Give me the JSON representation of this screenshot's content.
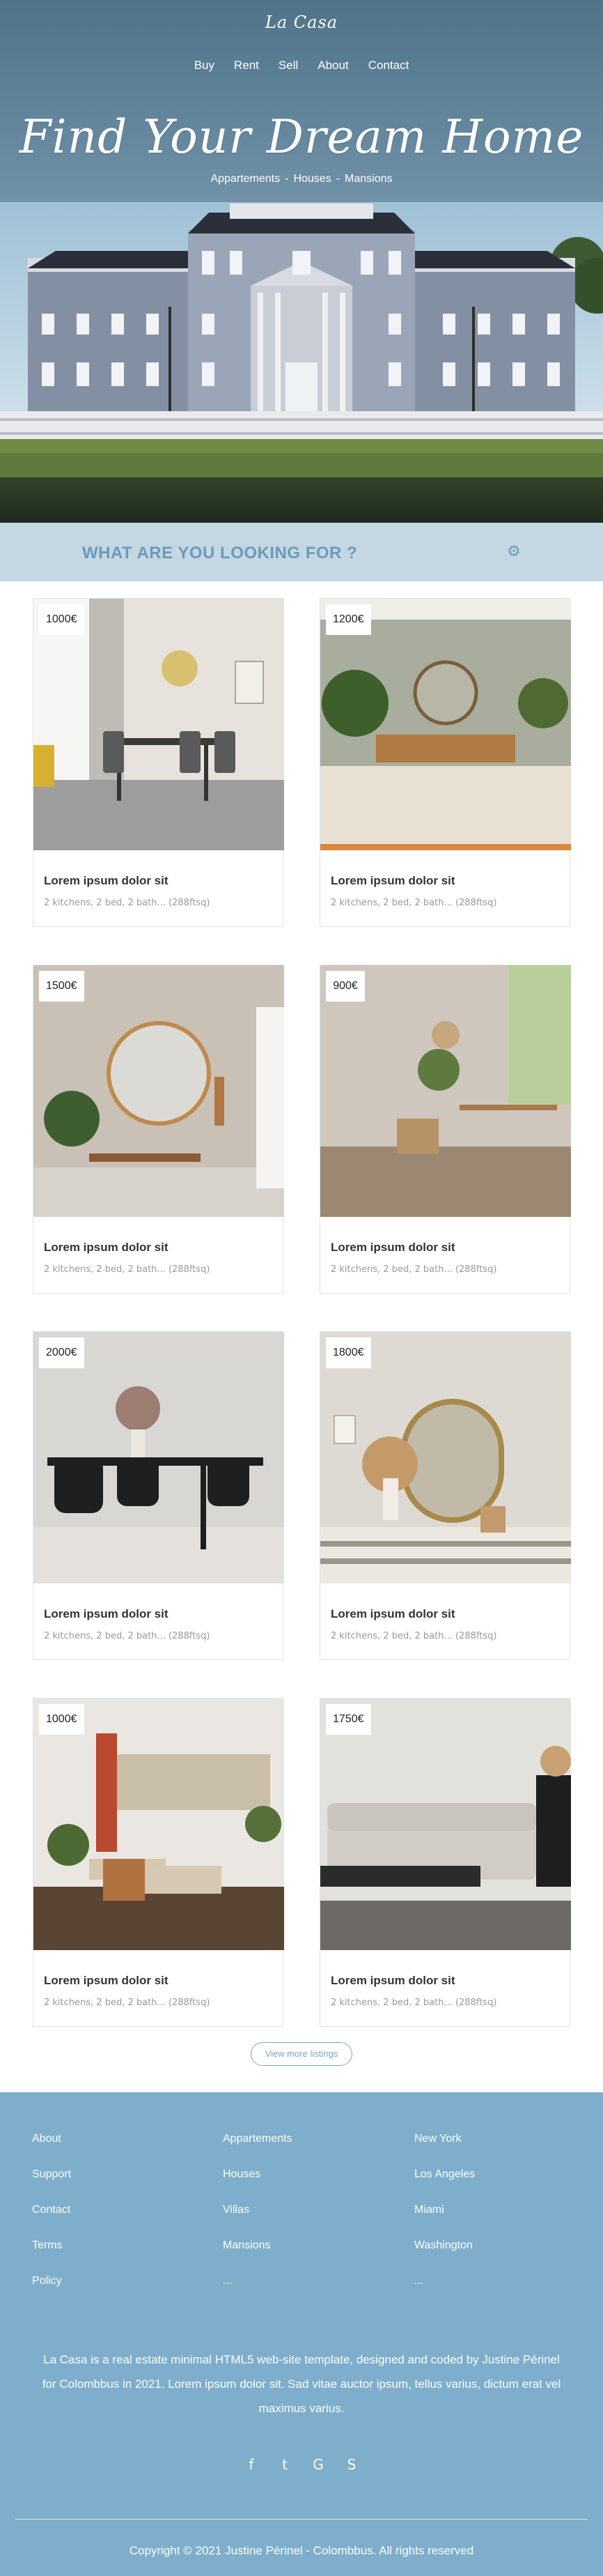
{
  "brand": {
    "logo": "La Casa"
  },
  "nav": [
    "Buy",
    "Rent",
    "Sell",
    "About",
    "Contact"
  ],
  "hero": {
    "title": "Find Your Dream Home",
    "categories": [
      "Appartements",
      "Houses",
      "Mansions"
    ]
  },
  "search": {
    "title": "WHAT ARE YOU LOOKING FOR ?",
    "icon": "gear-icon"
  },
  "listings": [
    {
      "price": "1000€",
      "title": "Lorem ipsum dolor sit",
      "meta": "2 kitchens, 2 bed, 2 bath... (288ftsq)"
    },
    {
      "price": "1200€",
      "title": "Lorem ipsum dolor sit",
      "meta": "2 kitchens, 2 bed, 2 bath... (288ftsq)"
    },
    {
      "price": "1500€",
      "title": "Lorem ipsum dolor sit",
      "meta": "2 kitchens, 2 bed, 2 bath... (288ftsq)"
    },
    {
      "price": "900€",
      "title": "Lorem ipsum dolor sit",
      "meta": "2 kitchens, 2 bed, 2 bath... (288ftsq)"
    },
    {
      "price": "2000€",
      "title": "Lorem ipsum dolor sit",
      "meta": "2 kitchens, 2 bed, 2 bath... (288ftsq)"
    },
    {
      "price": "1800€",
      "title": "Lorem ipsum dolor sit",
      "meta": "2 kitchens, 2 bed, 2 bath... (288ftsq)"
    },
    {
      "price": "1000€",
      "title": "Lorem ipsum dolor sit",
      "meta": "2 kitchens, 2 bed, 2 bath... (288ftsq)"
    },
    {
      "price": "1750€",
      "title": "Lorem ipsum dolor sit",
      "meta": "2 kitchens, 2 bed, 2 bath... (288ftsq)"
    }
  ],
  "more_button": "View more listings",
  "footer": {
    "col1": [
      "About",
      "Support",
      "Contact",
      "Terms",
      "Policy"
    ],
    "col2": [
      "Appartements",
      "Houses",
      "Villas",
      "Mansions",
      "..."
    ],
    "col3": [
      "New York",
      "Los Angeles",
      "Miami",
      "Washington",
      "..."
    ],
    "about": "La Casa is a real estate minimal HTML5 web-site template, designed and coded by Justine Périnel for Colombbus in 2021. Lorem ipsum dolor sit. Sad vitae auctor ipsum, tellus varius, dictum erat vel maximus varius.",
    "socials": [
      "f",
      "t",
      "G",
      "S"
    ],
    "social_icons": [
      "facebook-icon",
      "twitter-icon",
      "google-icon",
      "skype-icon"
    ],
    "copyright": "Copyright © 2021 Justine Périnel - Colombbus. All rights reserved"
  },
  "colors": {
    "accent": "#7eaecb",
    "search_bar": "#c4d7e2",
    "search_text": "#6a9bb9"
  }
}
